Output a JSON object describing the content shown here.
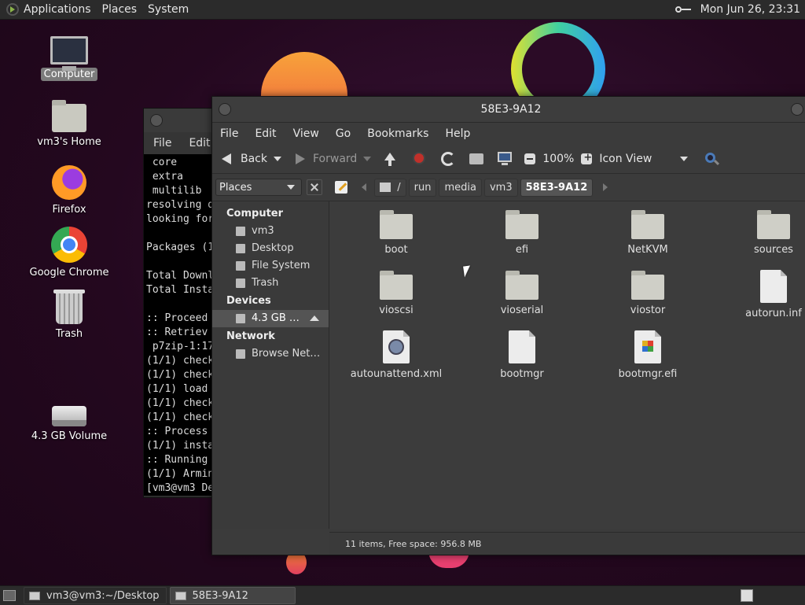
{
  "top_panel": {
    "menus": [
      "Applications",
      "Places",
      "System"
    ],
    "clock": "Mon Jun 26, 23:31"
  },
  "desktop_icons": {
    "computer": "Computer",
    "home": "vm3's Home",
    "firefox": "Firefox",
    "chrome": "Google Chrome",
    "trash": "Trash",
    "volume": "4.3 GB Volume"
  },
  "terminal": {
    "menu": [
      "File",
      "Edit"
    ],
    "lines": [
      " core",
      " extra",
      " multilib",
      "resolving d",
      "looking for",
      "",
      "Packages (1",
      "",
      "Total Downl",
      "Total Insta",
      "",
      ":: Proceed",
      ":: Retriev",
      " p7zip-1:17",
      "(1/1) check",
      "(1/1) check",
      "(1/1) load",
      "(1/1) check",
      "(1/1) check",
      ":: Process",
      "(1/1) insta",
      ":: Running",
      "(1/1) Armin",
      "[vm3@vm3 De"
    ]
  },
  "file_manager": {
    "title": "58E3-9A12",
    "menu": [
      "File",
      "Edit",
      "View",
      "Go",
      "Bookmarks",
      "Help"
    ],
    "toolbar": {
      "back": "Back",
      "forward": "Forward",
      "zoom": "100%",
      "view_mode": "Icon View"
    },
    "places_label": "Places",
    "path": [
      "/",
      "run",
      "media",
      "vm3",
      "58E3-9A12"
    ],
    "sidebar": {
      "computer_header": "Computer",
      "computer_items": [
        "vm3",
        "Desktop",
        "File System",
        "Trash"
      ],
      "devices_header": "Devices",
      "device_item": "4.3 GB …",
      "network_header": "Network",
      "network_item": "Browse Net…"
    },
    "files": [
      {
        "name": "boot",
        "type": "folder"
      },
      {
        "name": "efi",
        "type": "folder"
      },
      {
        "name": "NetKVM",
        "type": "folder"
      },
      {
        "name": "sources",
        "type": "folder"
      },
      {
        "name": "vioscsi",
        "type": "folder"
      },
      {
        "name": "vioserial",
        "type": "folder"
      },
      {
        "name": "viostor",
        "type": "folder"
      },
      {
        "name": "autorun.inf",
        "type": "file"
      },
      {
        "name": "autounattend.xml",
        "type": "xml"
      },
      {
        "name": "bootmgr",
        "type": "file"
      },
      {
        "name": "bootmgr.efi",
        "type": "efi"
      }
    ],
    "status": "11 items, Free space: 956.8 MB"
  },
  "taskbar": {
    "tasks": [
      "vm3@vm3:~/Desktop",
      "58E3-9A12"
    ]
  }
}
